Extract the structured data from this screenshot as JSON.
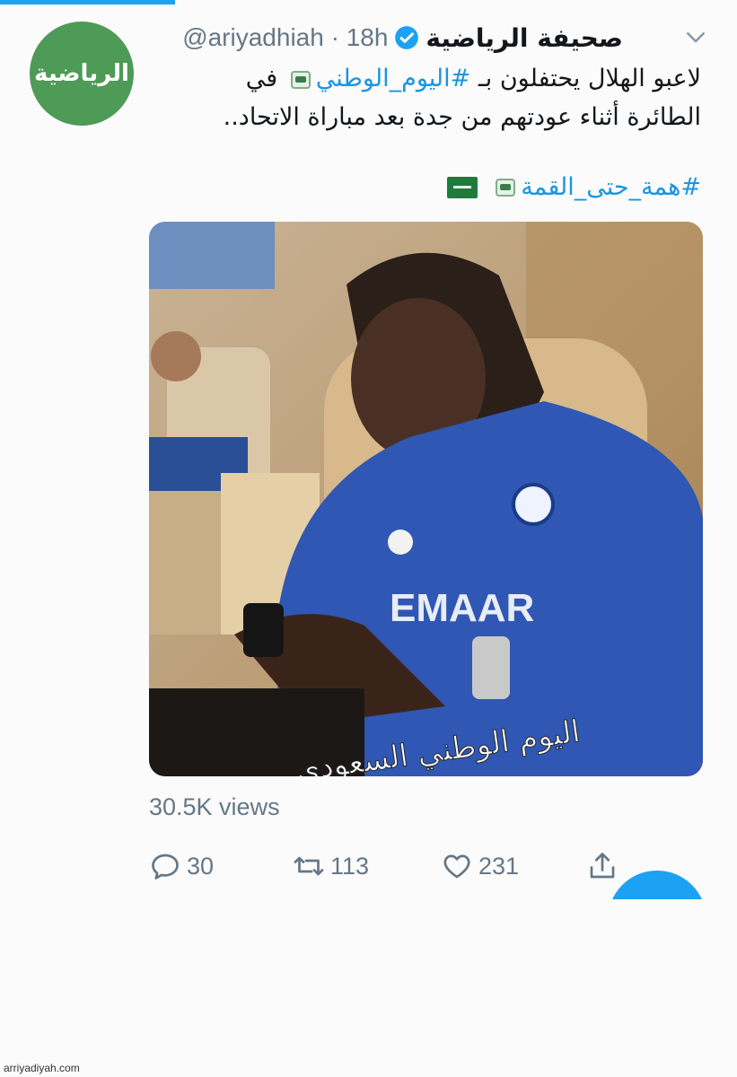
{
  "account": {
    "avatar_text": "الرياضية",
    "name": "صحيفة الرياضية",
    "handle_time": "@ariyadhiah · 18h"
  },
  "tweet": {
    "line1_text": "لاعبو الهلال يحتفلون بـ ",
    "line1_hashtag": "#اليوم_الوطني",
    "line1_end": " في",
    "line2": "الطائرة أثناء عودتهم من جدة بعد مباراة الاتحاد..",
    "hashtag2": "#همة_حتى_القمة"
  },
  "media": {
    "jersey_text": "EMAAR",
    "caption": "اليوم الوطني السعودي"
  },
  "stats": {
    "views": "30.5K views",
    "replies": "30",
    "retweets": "113",
    "likes": "231"
  },
  "icons": [
    "verified-badge-icon",
    "chevron-down-icon",
    "reply-icon",
    "retweet-icon",
    "like-icon",
    "share-icon",
    "saudi-flag-icon"
  ],
  "colors": {
    "accent": "#1da1f2",
    "hashtag": "#1b95e0",
    "avatar_bg": "#4e9a57",
    "muted": "#657786"
  },
  "footer": {
    "credit": "arriyadiyah.com"
  }
}
